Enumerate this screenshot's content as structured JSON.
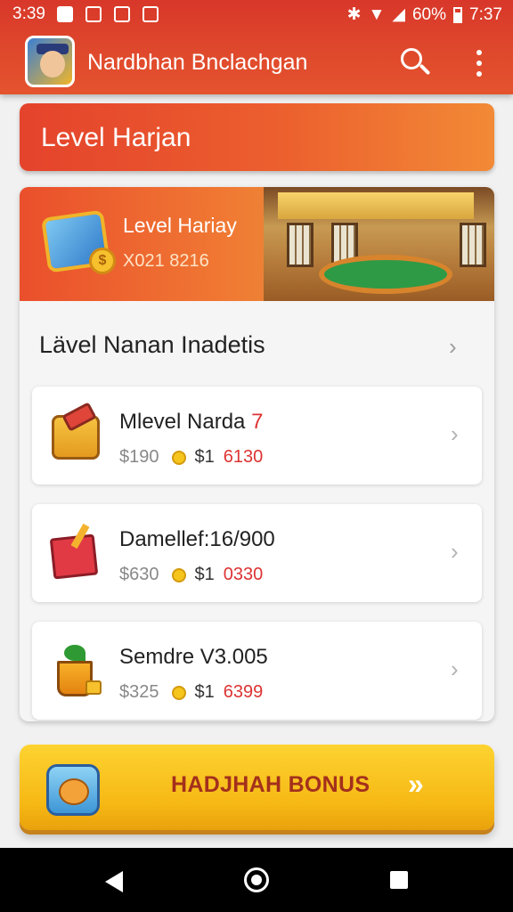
{
  "status_bar": {
    "time": "3:39",
    "battery": "60%",
    "clock_right": "7:37"
  },
  "app_bar": {
    "title": "Nardbhan Bnclachgan",
    "icons": [
      "avatar-logo",
      "search-icon",
      "more-vert-icon"
    ]
  },
  "level_banner": {
    "title": "Level Harjan"
  },
  "hero": {
    "title": "Level Hariay",
    "subtitle": "X021 8216"
  },
  "section": {
    "title": "Lävel Nanan Inadetis"
  },
  "items": [
    {
      "name": "Mlevel Narda",
      "name_highlight": "7",
      "price_old": "$190",
      "price_coin": "$1",
      "price_red": "6130",
      "icon": "bag-icon"
    },
    {
      "name": "Damellef:16/900",
      "name_highlight": "",
      "price_old": "$630",
      "price_coin": "$1",
      "price_red": "0330",
      "icon": "gift-box-icon"
    },
    {
      "name": "Semdre V3.005",
      "name_highlight": "",
      "price_old": "$325",
      "price_coin": "$1",
      "price_red": "6399",
      "icon": "plant-pot-icon"
    }
  ],
  "bonus": {
    "label": "HADJHAH BONUS",
    "arrow": "»"
  },
  "colors": {
    "appbar": "#d8372a",
    "banner": "#e4432c",
    "bonus": "#f6b814",
    "accent_red": "#dd3333"
  }
}
